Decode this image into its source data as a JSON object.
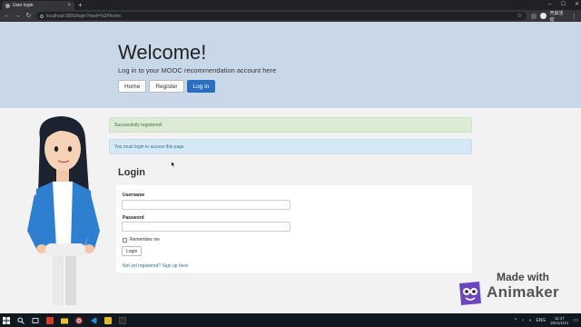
{
  "browser": {
    "tab_title": "User login",
    "url": "localhost:3000/login?next=%2Fhome",
    "profile_name": "开启活动",
    "new_tab": "+",
    "close": "×"
  },
  "header": {
    "title": "Welcome!",
    "subtitle": "Log in to your MOOC recommendation account here",
    "nav": [
      {
        "label": "Home"
      },
      {
        "label": "Register"
      },
      {
        "label": "Log in",
        "active": true
      }
    ]
  },
  "alerts": {
    "success": "Successfully registered!",
    "info": "You must login to access this page"
  },
  "login": {
    "title": "Login",
    "username_label": "Username",
    "password_label": "Password",
    "username_value": "",
    "password_value": "",
    "remember_label": "Remember me",
    "remember_checked": false,
    "button": "Login",
    "signup_link": "Not yet registered? Sign up here"
  },
  "watermark": {
    "line1": "Made with",
    "line2": "Animaker"
  },
  "taskbar": {
    "lang": "ENG",
    "time": "11:47",
    "date": "2021/1/21"
  },
  "colors": {
    "jumbotron": "#c8d8e8",
    "primary": "#2a6fbf",
    "success_bg": "#dcebd4",
    "info_bg": "#d6e8f5"
  },
  "icons": [
    "back-arrow-icon",
    "forward-arrow-icon",
    "reload-icon",
    "info-icon",
    "star-icon",
    "menu-dots-icon",
    "windows-start-icon",
    "search-icon"
  ]
}
